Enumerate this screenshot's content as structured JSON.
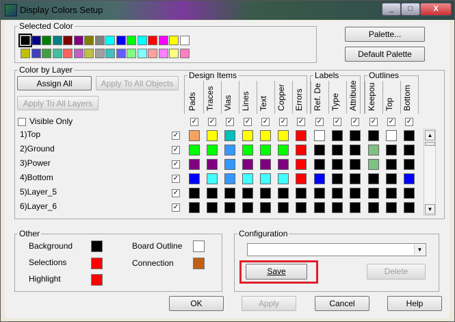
{
  "window": {
    "title": "Display Colors Setup",
    "controls": [
      "_",
      "□",
      "X"
    ]
  },
  "selected_color": {
    "legend": "Selected Color",
    "row1": [
      "#000000",
      "#000080",
      "#008000",
      "#008080",
      "#800000",
      "#800080",
      "#808000",
      "#808080",
      "#00ffff",
      "#0000ff",
      "#00ff00",
      "#00ffff",
      "#ff0000",
      "#ff00ff",
      "#ffff00",
      "#ffffff"
    ],
    "row2": [
      "#c0c000",
      "#4040c0",
      "#40a040",
      "#40c0a0",
      "#ff6060",
      "#c060c0",
      "#c0c040",
      "#a0a0a0",
      "#40c0c0",
      "#6060ff",
      "#80ff80",
      "#80ffff",
      "#ffa0a0",
      "#ff80ff",
      "#ffff80",
      "#ff80c0"
    ]
  },
  "buttons": {
    "palette": "Palette...",
    "default_palette": "Default Palette"
  },
  "color_by_layer": {
    "legend": "Color by Layer",
    "assign_all": "Assign All",
    "apply_all_objects": "Apply To All Objects",
    "apply_all_layers": "Apply To All Layers",
    "visible_only": "Visible Only",
    "design_items_legend": "Design Items",
    "labels_legend": "Labels",
    "outlines_legend": "Outlines",
    "columns": [
      "Pads",
      "Traces",
      "Vias",
      "Lines",
      "Text",
      "Copper",
      "Errors",
      "Ref. De",
      "Type",
      "Attribute",
      "Keepou",
      "Top",
      "Bottom"
    ],
    "layers": [
      {
        "name": "1)Top",
        "colors": [
          "#f4a460",
          "#ffff00",
          "#00c0c0",
          "#ffff00",
          "#ffff00",
          "#ffff00",
          "#ff0000",
          "#ffffff",
          "#000000",
          "#000000",
          "#000000",
          "#ffffff",
          "#000000"
        ]
      },
      {
        "name": "2)Ground",
        "colors": [
          "#00ff00",
          "#00ff00",
          "#3399ff",
          "#00ff00",
          "#00ff00",
          "#00ff00",
          "#ff0000",
          "#000000",
          "#000000",
          "#000000",
          "#80c080",
          "#000000",
          "#000000"
        ]
      },
      {
        "name": "3)Power",
        "colors": [
          "#800080",
          "#800080",
          "#3399ff",
          "#800080",
          "#800080",
          "#800080",
          "#ff0000",
          "#000000",
          "#000000",
          "#000000",
          "#80c080",
          "#000000",
          "#000000"
        ]
      },
      {
        "name": "4)Bottom",
        "colors": [
          "#0000ff",
          "#40ffff",
          "#3399ff",
          "#40ffff",
          "#40ffff",
          "#40ffff",
          "#ff0000",
          "#0000ff",
          "#000000",
          "#000000",
          "#000000",
          "#000000",
          "#0000ff"
        ]
      },
      {
        "name": "5)Layer_5",
        "colors": [
          "#000000",
          "#000000",
          "#000000",
          "#000000",
          "#000000",
          "#000000",
          "#000000",
          "#000000",
          "#000000",
          "#000000",
          "#000000",
          "#000000",
          "#000000"
        ]
      },
      {
        "name": "6)Layer_6",
        "colors": [
          "#000000",
          "#000000",
          "#000000",
          "#000000",
          "#000000",
          "#000000",
          "#000000",
          "#000000",
          "#000000",
          "#000000",
          "#000000",
          "#000000",
          "#000000"
        ]
      }
    ]
  },
  "other": {
    "legend": "Other",
    "background_label": "Background",
    "background_color": "#000000",
    "selections_label": "Selections",
    "selections_color": "#ff0000",
    "highlight_label": "Highlight",
    "highlight_color": "#ff0000",
    "board_outline_label": "Board Outline",
    "board_outline_color": "#ffffff",
    "connection_label": "Connection",
    "connection_color": "#c06010"
  },
  "configuration": {
    "legend": "Configuration",
    "value": "",
    "save": "Save",
    "delete": "Delete"
  },
  "footer": {
    "ok": "OK",
    "apply": "Apply",
    "cancel": "Cancel",
    "help": "Help"
  },
  "accent": "#e0202a"
}
